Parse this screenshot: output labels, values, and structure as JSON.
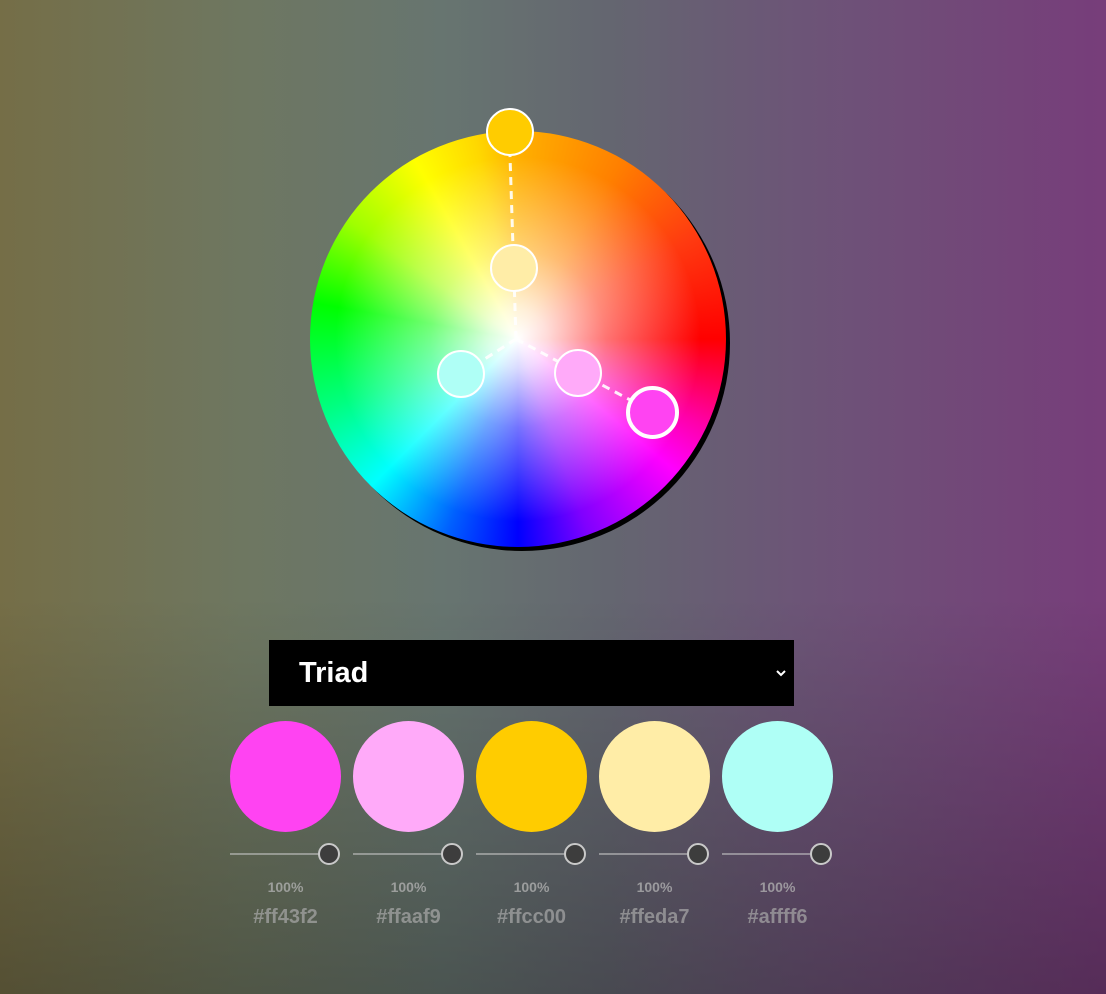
{
  "harmony": {
    "selected_label": "Triad"
  },
  "wheel": {
    "handles": [
      {
        "name": "handle-yellow",
        "color": "#ffcc00"
      },
      {
        "name": "handle-light-yellow",
        "color": "#ffeda7"
      },
      {
        "name": "handle-light-cyan",
        "color": "#affff6"
      },
      {
        "name": "handle-light-pink",
        "color": "#ffaaf9"
      },
      {
        "name": "handle-magenta-active",
        "color": "#ff43f2"
      }
    ]
  },
  "swatches": [
    {
      "color": "#ff43f2",
      "percent": "100%",
      "hex": "#ff43f2",
      "opacity": 1.0
    },
    {
      "color": "#ffaaf9",
      "percent": "100%",
      "hex": "#ffaaf9",
      "opacity": 1.0
    },
    {
      "color": "#ffcc00",
      "percent": "100%",
      "hex": "#ffcc00",
      "opacity": 1.0
    },
    {
      "color": "#ffeda7",
      "percent": "100%",
      "hex": "#ffeda7",
      "opacity": 1.0
    },
    {
      "color": "#affff6",
      "percent": "100%",
      "hex": "#affff6",
      "opacity": 1.0
    }
  ]
}
